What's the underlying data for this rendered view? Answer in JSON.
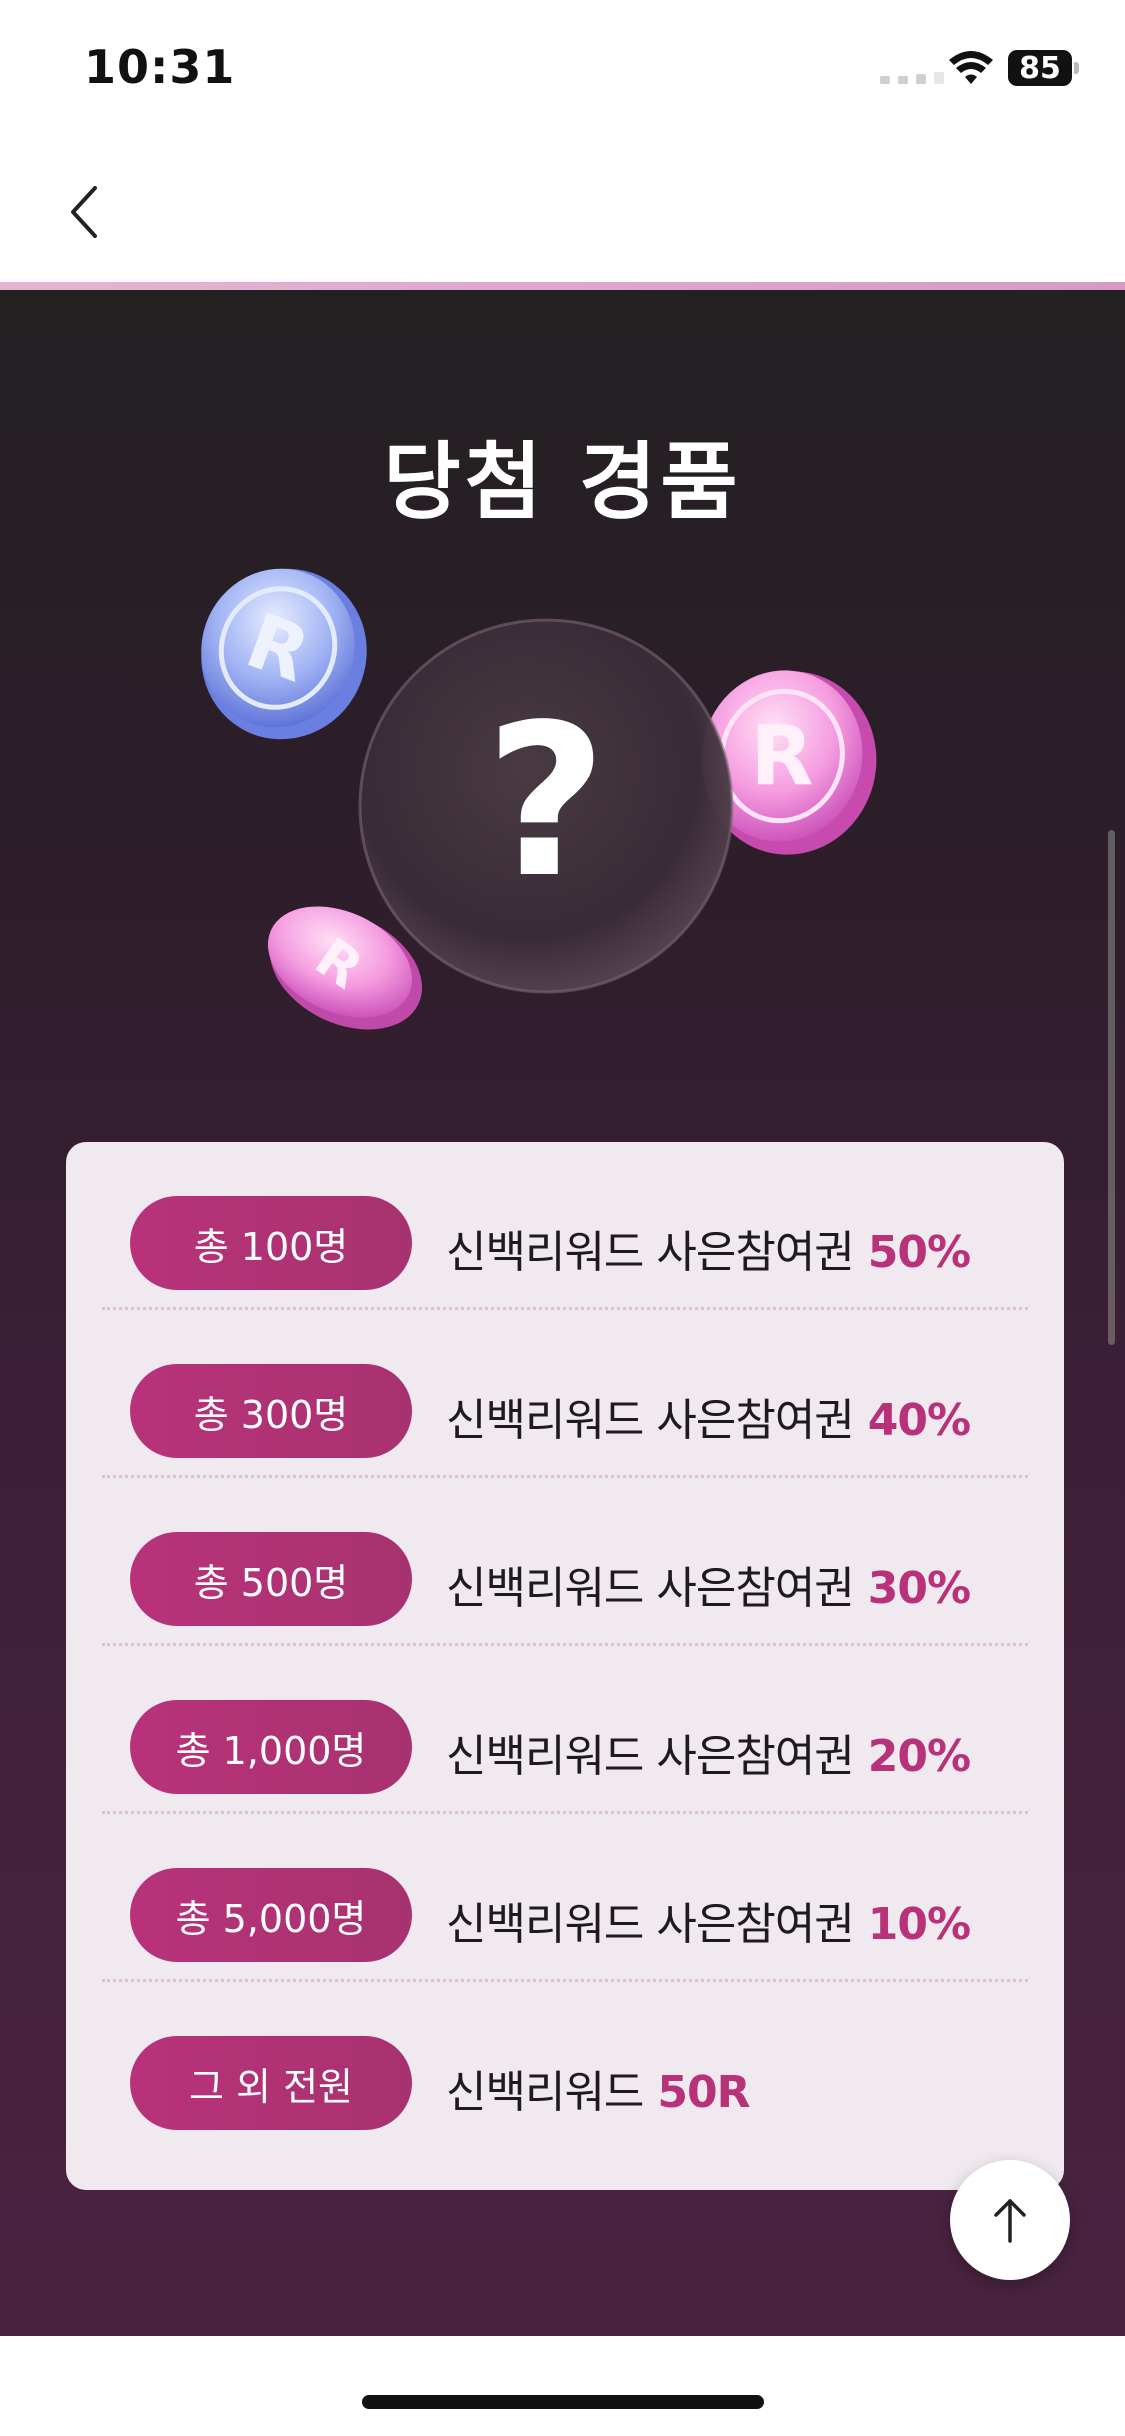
{
  "status_bar": {
    "time": "10:31",
    "battery": "85",
    "icons": [
      "signal-icon",
      "wifi-icon",
      "battery-icon"
    ]
  },
  "nav": {
    "back_icon": "chevron-left-icon"
  },
  "section": {
    "title": "당첨 경품",
    "hero_mystery_symbol": "?",
    "coin_symbol": "R"
  },
  "prizes": [
    {
      "badge": "총 100명",
      "label": "신백리워드 사은참여권",
      "value": "50%"
    },
    {
      "badge": "총 300명",
      "label": "신백리워드 사은참여권",
      "value": "40%"
    },
    {
      "badge": "총 500명",
      "label": "신백리워드 사은참여권",
      "value": "30%"
    },
    {
      "badge": "총 1,000명",
      "label": "신백리워드 사은참여권",
      "value": "20%"
    },
    {
      "badge": "총 5,000명",
      "label": "신백리워드 사은참여권",
      "value": "10%"
    },
    {
      "badge": "그 외 전원",
      "label": "신백리워드",
      "value": "50R"
    }
  ],
  "colors": {
    "accent": "#b8327a",
    "card_bg": "#f0e9f0",
    "bg_top": "#232022",
    "bg_bottom": "#4a2341"
  },
  "scroll_top": {
    "icon": "arrow-up-icon"
  }
}
